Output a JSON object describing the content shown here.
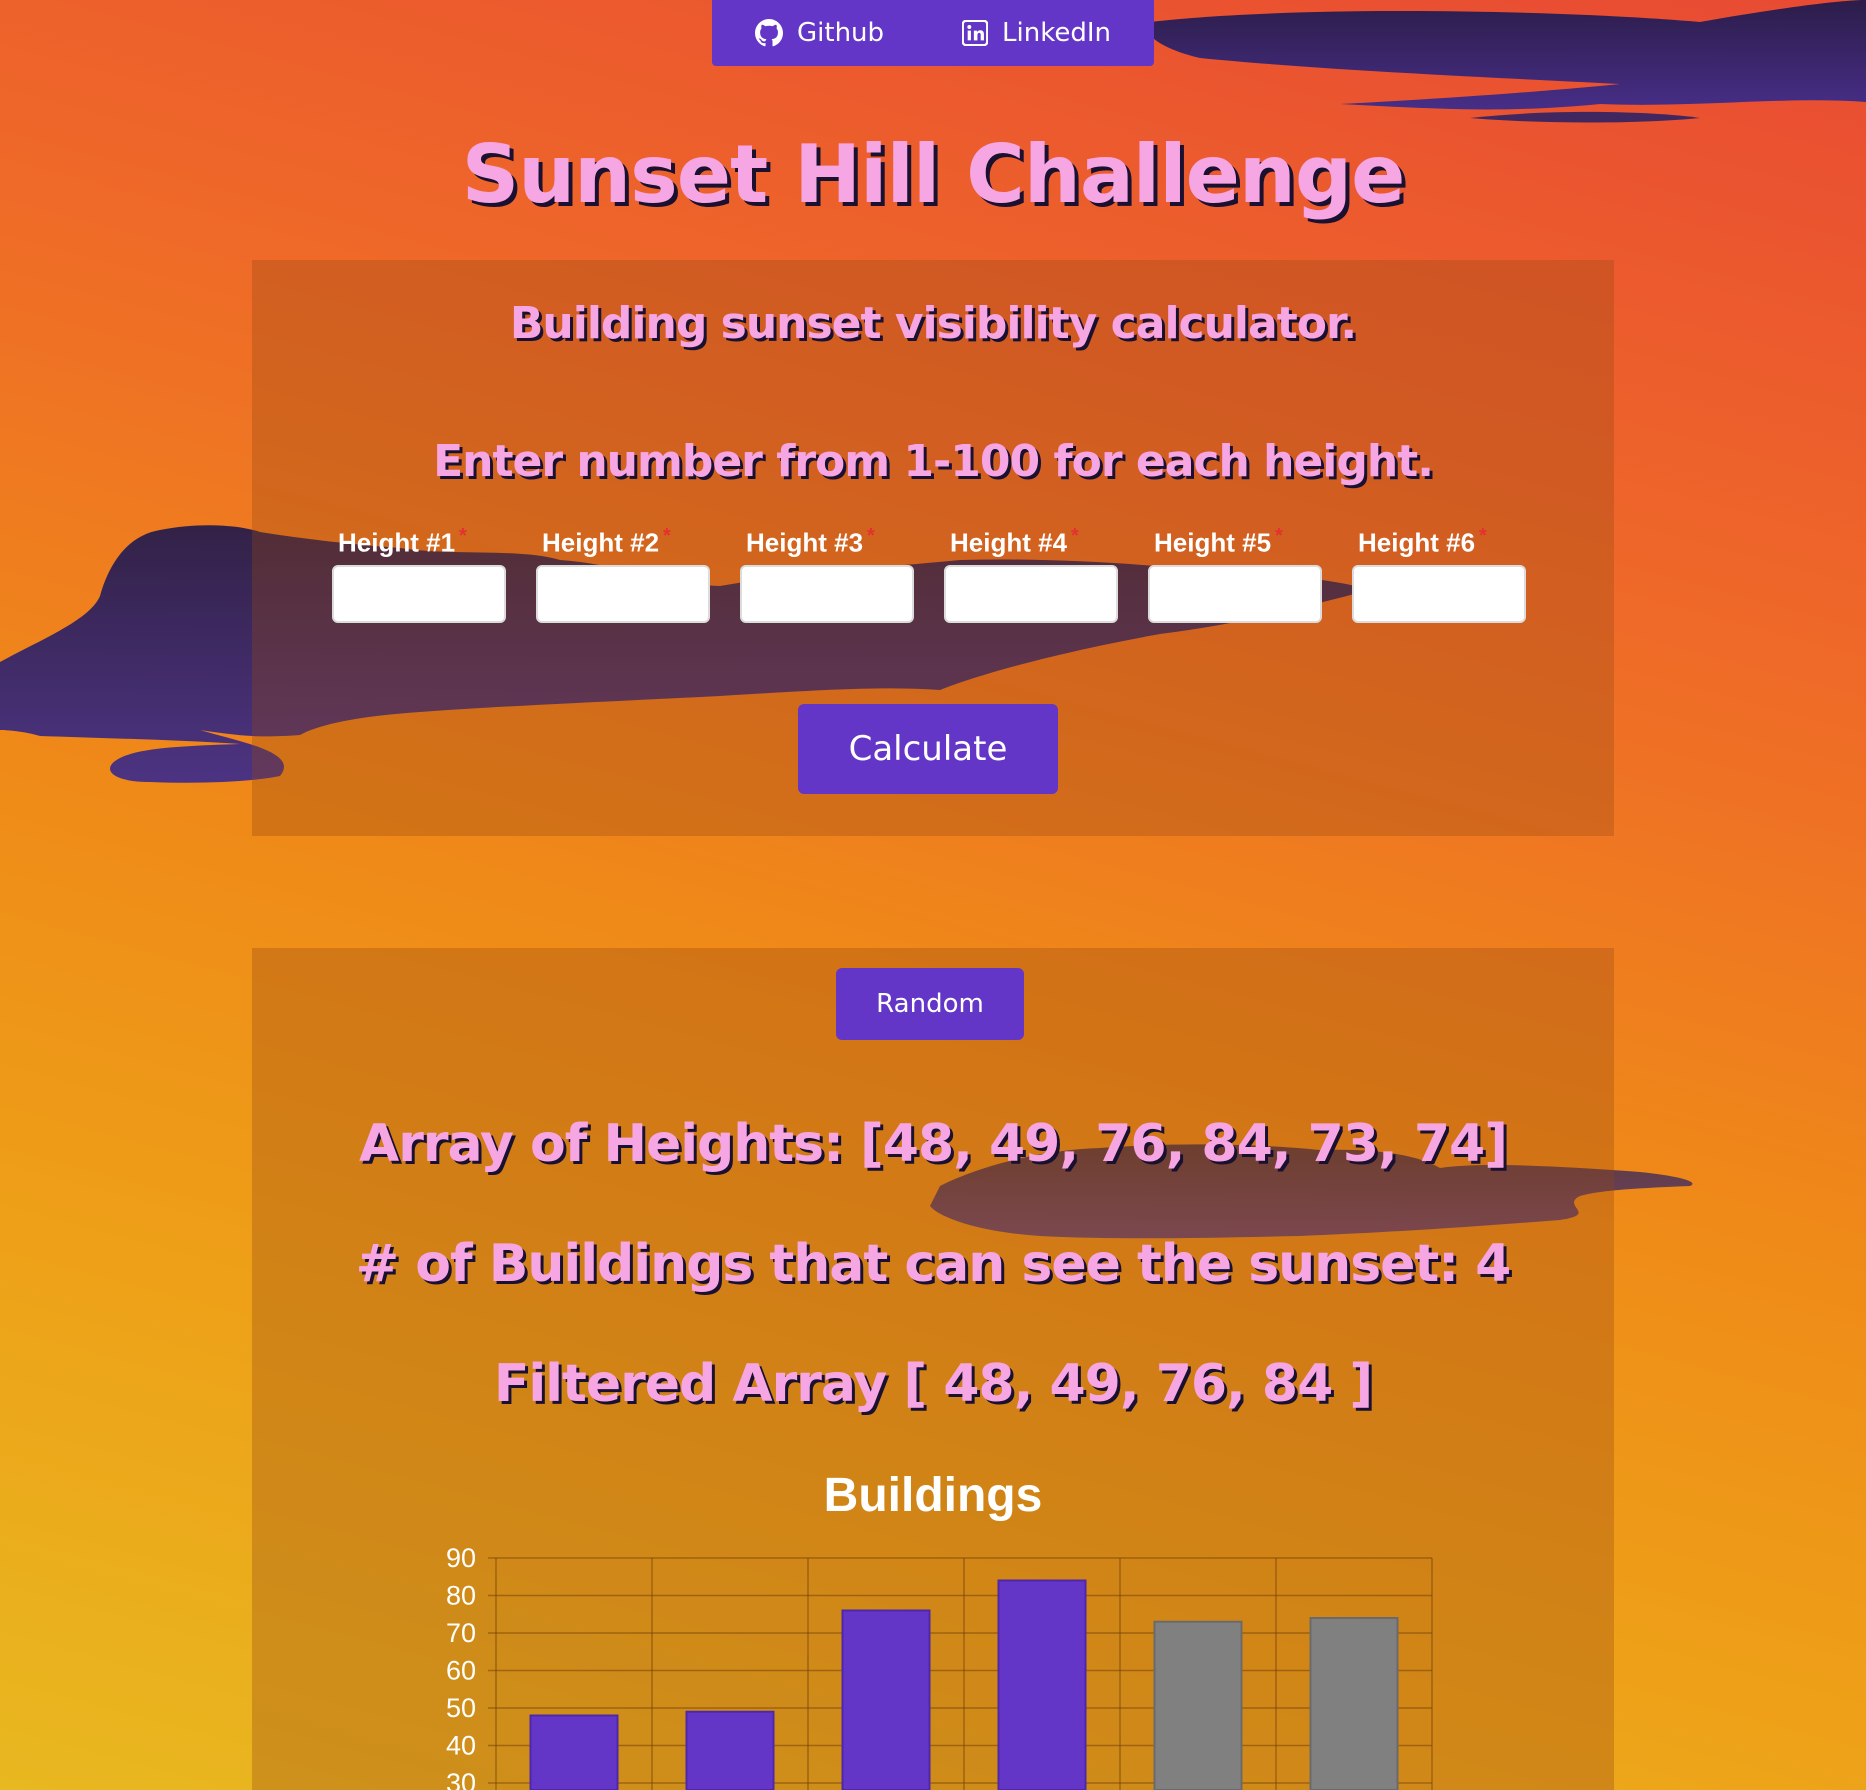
{
  "nav": {
    "github": {
      "label": "Github",
      "icon": "github-icon"
    },
    "linkedin": {
      "label": "LinkedIn",
      "icon": "linkedin-icon"
    }
  },
  "title": "Sunset Hill Challenge",
  "calculator": {
    "subtitle": "Building sunset visibility calculator.",
    "instructions": "Enter number from 1-100 for each height.",
    "fields": [
      {
        "label": "Height #1",
        "value": ""
      },
      {
        "label": "Height #2",
        "value": ""
      },
      {
        "label": "Height #3",
        "value": ""
      },
      {
        "label": "Height #4",
        "value": ""
      },
      {
        "label": "Height #5",
        "value": ""
      },
      {
        "label": "Height #6",
        "value": ""
      }
    ],
    "required_marker": "*",
    "calculate_label": "Calculate"
  },
  "results": {
    "random_label": "Random",
    "array_text": "Array of Heights: [48, 49, 76, 84, 73, 74]",
    "count_text": "# of Buildings that can see the sunset: 4",
    "filtered_text": "Filtered Array [ 48, 49, 76, 84 ]"
  },
  "colors": {
    "accent": "#6436c8",
    "title_text": "#f7a6e4",
    "visible_bar": "#6436c8",
    "blocked_bar": "#808080"
  },
  "chart_data": {
    "type": "bar",
    "title": "Buildings",
    "xlabel": "",
    "ylabel": "",
    "values": [
      48,
      49,
      76,
      84,
      73,
      74
    ],
    "can_see_sunset": [
      true,
      true,
      true,
      true,
      false,
      false
    ],
    "ylim": [
      0,
      90
    ],
    "yticks": [
      90,
      80,
      70,
      60,
      50,
      40,
      30
    ],
    "grid": true
  }
}
